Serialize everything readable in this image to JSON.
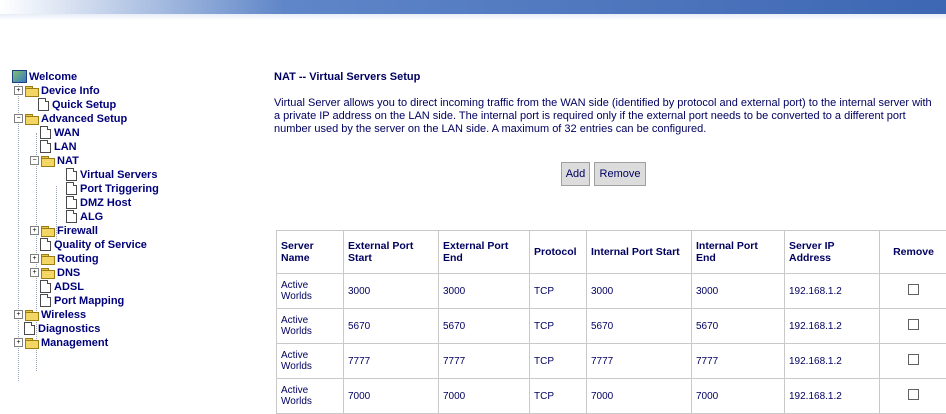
{
  "nav": {
    "welcome": "Welcome",
    "device_info": "Device Info",
    "quick_setup": "Quick Setup",
    "advanced_setup": "Advanced Setup",
    "wan": "WAN",
    "lan": "LAN",
    "nat": "NAT",
    "virtual_servers": "Virtual Servers",
    "port_triggering": "Port Triggering",
    "dmz_host": "DMZ Host",
    "alg": "ALG",
    "firewall": "Firewall",
    "qos": "Quality of Service",
    "routing": "Routing",
    "dns": "DNS",
    "adsl": "ADSL",
    "port_mapping": "Port Mapping",
    "wireless": "Wireless",
    "diagnostics": "Diagnostics",
    "management": "Management"
  },
  "main": {
    "title": "NAT -- Virtual Servers Setup",
    "description": "Virtual Server allows you to direct incoming traffic from the WAN side (identified by protocol and external port) to the internal server with a private IP address on the LAN side. The internal port is required only if the external port needs to be converted to a different port number used by the server on the LAN side. A maximum of 32 entries can be configured.",
    "add_label": "Add",
    "remove_label": "Remove"
  },
  "table": {
    "headers": [
      "Server Name",
      "External Port Start",
      "External Port End",
      "Protocol",
      "Internal Port Start",
      "Internal Port End",
      "Server IP Address",
      "Remove"
    ],
    "rows": [
      [
        "Active Worlds",
        "3000",
        "3000",
        "TCP",
        "3000",
        "3000",
        "192.168.1.2"
      ],
      [
        "Active Worlds",
        "5670",
        "5670",
        "TCP",
        "5670",
        "5670",
        "192.168.1.2"
      ],
      [
        "Active Worlds",
        "7777",
        "7777",
        "TCP",
        "7777",
        "7777",
        "192.168.1.2"
      ],
      [
        "Active Worlds",
        "7000",
        "7000",
        "TCP",
        "7000",
        "7000",
        "192.168.1.2"
      ]
    ]
  }
}
